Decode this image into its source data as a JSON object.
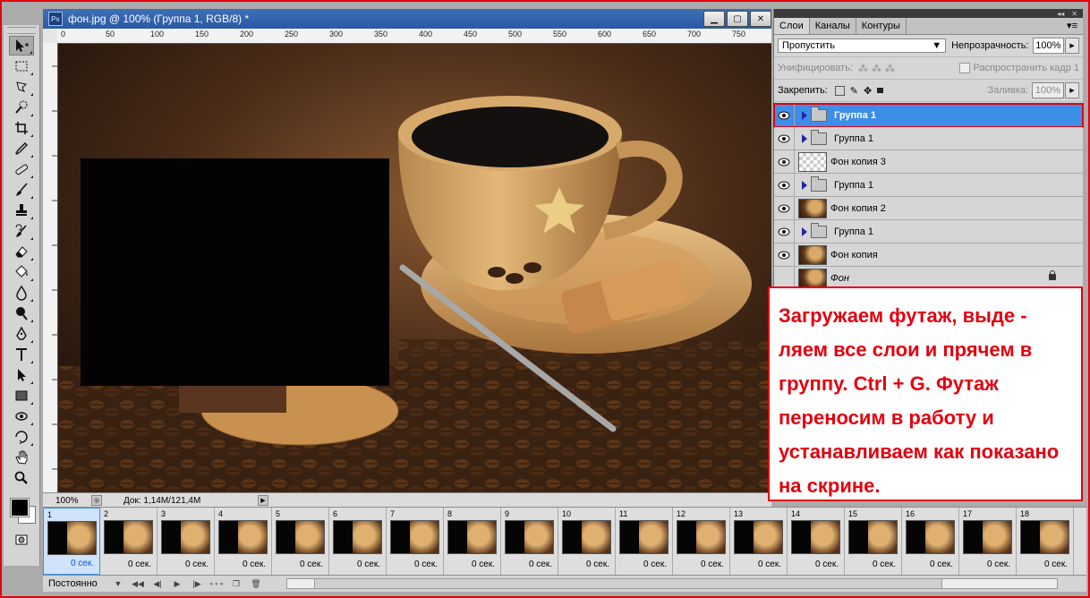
{
  "document": {
    "title": "фон.jpg @ 100% (Группа 1, RGB/8) *",
    "app_icon": "Ps",
    "ruler_marks": [
      "0",
      "50",
      "100",
      "150",
      "200",
      "250",
      "300",
      "350",
      "400",
      "450",
      "500",
      "550",
      "600",
      "650",
      "700",
      "750"
    ],
    "zoom": "100%",
    "doc_info": "Док: 1,14M/121,4M"
  },
  "layers_panel": {
    "tabs": [
      "Слои",
      "Каналы",
      "Контуры"
    ],
    "blend_mode": "Пропустить",
    "opacity_label": "Непрозрачность:",
    "opacity_value": "100%",
    "unify_label": "Унифицировать:",
    "propagate_label": "Распространить кадр 1",
    "lock_label": "Закрепить:",
    "fill_label": "Заливка:",
    "fill_value": "100%",
    "layers": [
      {
        "name": "Группа 1",
        "type": "group",
        "selected": true
      },
      {
        "name": "Группа 1",
        "type": "group"
      },
      {
        "name": "Фон копия 3",
        "type": "layer",
        "thumb": "transparent"
      },
      {
        "name": "Группа 1",
        "type": "group"
      },
      {
        "name": "Фон копия 2",
        "type": "layer",
        "thumb": "coffee"
      },
      {
        "name": "Группа 1",
        "type": "group"
      },
      {
        "name": "Фон копия",
        "type": "layer",
        "thumb": "coffee"
      },
      {
        "name": "Фон",
        "type": "background",
        "thumb": "coffee",
        "hidden": true
      }
    ]
  },
  "annotation": {
    "text": "Загружаем футаж, выде - ляем все слои и прячем в группу. Ctrl + G. Футаж переносим в работу и устанавливаем как показано на скрине."
  },
  "animation": {
    "frames": [
      {
        "num": "1",
        "delay": "0 сек."
      },
      {
        "num": "2",
        "delay": "0 сек."
      },
      {
        "num": "3",
        "delay": "0 сек."
      },
      {
        "num": "4",
        "delay": "0 сек."
      },
      {
        "num": "5",
        "delay": "0 сек."
      },
      {
        "num": "6",
        "delay": "0 сек."
      },
      {
        "num": "7",
        "delay": "0 сек."
      },
      {
        "num": "8",
        "delay": "0 сек."
      },
      {
        "num": "9",
        "delay": "0 сек."
      },
      {
        "num": "10",
        "delay": "0 сек."
      },
      {
        "num": "11",
        "delay": "0 сек."
      },
      {
        "num": "12",
        "delay": "0 сек."
      },
      {
        "num": "13",
        "delay": "0 сек."
      },
      {
        "num": "14",
        "delay": "0 сек."
      },
      {
        "num": "15",
        "delay": "0 сек."
      },
      {
        "num": "16",
        "delay": "0 сек."
      },
      {
        "num": "17",
        "delay": "0 сек."
      },
      {
        "num": "18",
        "delay": "0 сек."
      }
    ],
    "loop": "Постоянно"
  },
  "colors": {
    "accent": "#3d8ee9",
    "highlight_red": "#e3000f",
    "title_blue": "#2a5aa5"
  }
}
